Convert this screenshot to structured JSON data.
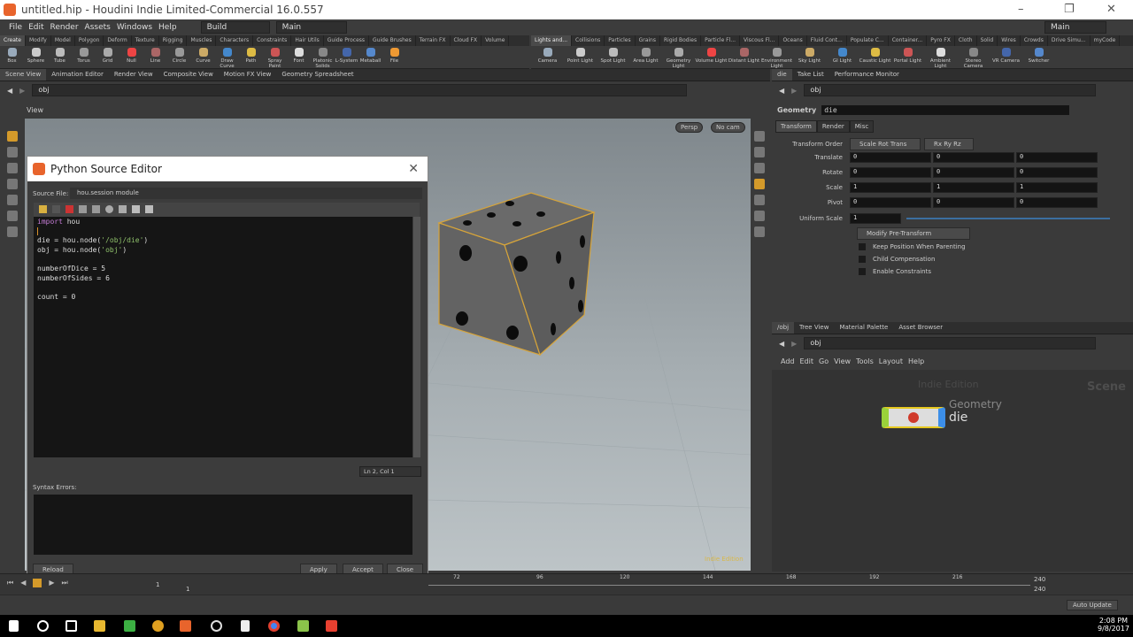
{
  "window": {
    "title": "untitled.hip - Houdini Indie Limited-Commercial 16.0.557"
  },
  "menu": [
    "File",
    "Edit",
    "Render",
    "Assets",
    "Windows",
    "Help"
  ],
  "desktop": "Build",
  "context": "Main",
  "context_right": "Main",
  "shelf_left": {
    "tabs": [
      "Create",
      "Modify",
      "Model",
      "Polygon",
      "Deform",
      "Texture",
      "Rigging",
      "Muscles",
      "Characters",
      "Constraints",
      "Hair Utils",
      "Guide Process",
      "Guide Brushes",
      "Terrain FX",
      "Cloud FX",
      "Volume"
    ],
    "tools": [
      "Box",
      "Sphere",
      "Tube",
      "Torus",
      "Grid",
      "Null",
      "Line",
      "Circle",
      "Curve",
      "Draw Curve",
      "Path",
      "Spray Paint",
      "Font",
      "Platonic Solids",
      "L-System",
      "Metaball",
      "File"
    ]
  },
  "shelf_right": {
    "tabs": [
      "Lights and...",
      "Collisions",
      "Particles",
      "Grains",
      "Rigid Bodies",
      "Particle Fl...",
      "Viscous Fl...",
      "Oceans",
      "Fluid Cont...",
      "Populate C...",
      "Container...",
      "Pyro FX",
      "Cloth",
      "Solid",
      "Wires",
      "Crowds",
      "Drive Simu...",
      "myCode"
    ],
    "tools": [
      "Camera",
      "Point Light",
      "Spot Light",
      "Area Light",
      "Geometry Light",
      "Volume Light",
      "Distant Light",
      "Environment Light",
      "Sky Light",
      "GI Light",
      "Caustic Light",
      "Portal Light",
      "Ambient Light",
      "Stereo Camera",
      "VR Camera",
      "Switcher"
    ]
  },
  "left_pane": {
    "tabs": [
      "Scene View",
      "Animation Editor",
      "Render View",
      "Composite View",
      "Motion FX View",
      "Geometry Spreadsheet"
    ],
    "path": "obj",
    "view_label": "View",
    "persp": "Persp",
    "cam": "No cam",
    "watermark": "Indie Edition"
  },
  "editor": {
    "title": "Python Source Editor",
    "source_label": "Source File:",
    "source_value": "hou.session module",
    "code": {
      "l1a": "import",
      "l1b": " hou",
      "l3a": "die = hou.node(",
      "l3b": "'/obj/die'",
      "l3c": ")",
      "l4a": "obj = hou.node(",
      "l4b": "'obj'",
      "l4c": ")",
      "l6": "numberOfDice = 5",
      "l7": "numberOfSides = 6",
      "l9": "count = 0"
    },
    "cursor_pos": "Ln 2, Col 1",
    "syntax_label": "Syntax Errors:",
    "reload": "Reload",
    "apply": "Apply",
    "accept": "Accept",
    "close": "Close"
  },
  "right_pane": {
    "tabs": [
      "die",
      "Take List",
      "Performance Monitor"
    ],
    "path": "obj",
    "node_type": "Geometry",
    "node_name": "die",
    "param_tabs": [
      "Transform",
      "Render",
      "Misc"
    ],
    "transform_order_label": "Transform Order",
    "transform_order": "Scale Rot Trans",
    "rot_order": "Rx Ry Rz",
    "rows": [
      {
        "label": "Translate",
        "v": [
          "0",
          "0",
          "0"
        ]
      },
      {
        "label": "Rotate",
        "v": [
          "0",
          "0",
          "0"
        ]
      },
      {
        "label": "Scale",
        "v": [
          "1",
          "1",
          "1"
        ]
      },
      {
        "label": "Pivot",
        "v": [
          "0",
          "0",
          "0"
        ]
      }
    ],
    "uniform_scale_label": "Uniform Scale",
    "uniform_scale": "1",
    "modify_menu": "Modify Pre-Transform",
    "checks": [
      "Keep Position When Parenting",
      "Child Compensation",
      "Enable Constraints"
    ]
  },
  "network": {
    "tabs": [
      "/obj",
      "Tree View",
      "Material Palette",
      "Asset Browser"
    ],
    "path": "obj",
    "menu": [
      "Add",
      "Edit",
      "Go",
      "View",
      "Tools",
      "Layout",
      "Help"
    ],
    "watermark": "Indie Edition",
    "context": "Scene",
    "node_type": "Geometry",
    "node_name": "die"
  },
  "timeline": {
    "ticks": [
      "72",
      "96",
      "120",
      "144",
      "168",
      "192",
      "216"
    ],
    "current": "1",
    "start": "1",
    "end": "240",
    "end2": "240"
  },
  "status": {
    "update": "Auto Update"
  },
  "taskbar": {
    "time": "2:08 PM",
    "date": "9/8/2017"
  }
}
